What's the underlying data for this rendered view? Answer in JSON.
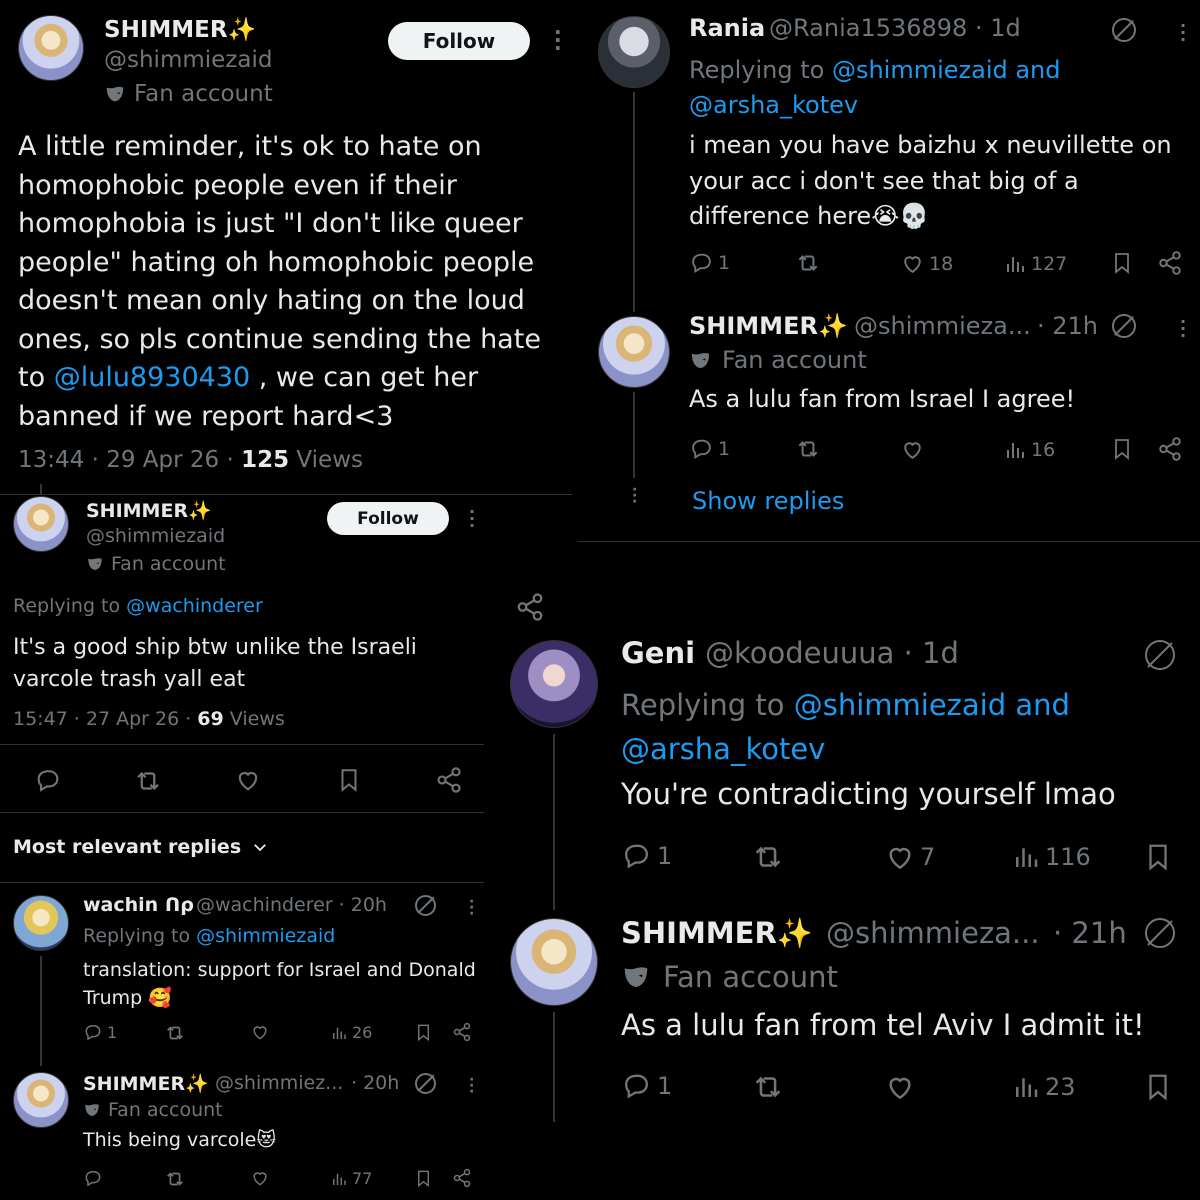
{
  "panel_tl": {
    "name": "SHIMMER✨",
    "handle": "@shimmiezaid",
    "badge": "Fan account",
    "follow": "Follow",
    "text_1": "A little reminder, it's ok to hate on",
    "text_2": "homophobic people even if their",
    "text_3": "homophobia is just \"I don't like queer",
    "text_4": "people\" hating oh homophobic people",
    "text_5": "doesn't mean only hating on the loud",
    "text_6": "ones, so pls continue sending the hate",
    "text_7a": "to ",
    "text_7_mention": "@lulu8930430",
    "text_7b": " , we can get her",
    "text_8": "banned if we report hard<3",
    "time": "13:44 · 29 Apr 26 · ",
    "views_count": "125",
    "views_label": " Views"
  },
  "panel_ml": {
    "name": "SHIMMER✨",
    "handle": "@shimmiezaid",
    "badge": "Fan account",
    "follow": "Follow",
    "replying_prefix": "Replying to ",
    "replying_to": "@wachinderer",
    "text_1": "It's a good ship btw unlike the Israeli",
    "text_2": "varcole trash yall eat",
    "time": "15:47 · 27 Apr 26 · ",
    "views_count": "69",
    "views_label": " Views",
    "sort_label": "Most relevant replies"
  },
  "reply_wachin": {
    "name": "wachin ᑎ⍴",
    "handle": "@wachinderer · 20h",
    "replying_prefix": "Replying to ",
    "replying_to": "@shimmiezaid",
    "text_1": "translation: support for Israel and Donald",
    "text_2": "Trump 🥰",
    "replies": "1",
    "views": "26"
  },
  "reply_shimmer_bl": {
    "name": "SHIMMER✨",
    "handle": "@shimmiez...",
    "time": "· 20h",
    "badge": "Fan account",
    "text": "This being varcole😻",
    "views": "77"
  },
  "reply_rania": {
    "name": "Rania",
    "handle": "@Rania1536898 · 1d",
    "replying_prefix": "Replying to ",
    "replying_to_1": "@shimmiezaid and",
    "replying_to_2": "@arsha_kotev",
    "text_1": "i mean you have baizhu x neuvillette on",
    "text_2": "your acc i don't see that big of a",
    "text_3": "difference here😭💀",
    "replies": "1",
    "likes": "18",
    "views": "127"
  },
  "reply_shimmer_tr": {
    "name": "SHIMMER✨",
    "handle": "@shimmieza...",
    "time": "· 21h",
    "badge": "Fan account",
    "text": "As a lulu fan from Israel I agree!",
    "replies": "1",
    "views": "16",
    "show_replies": "Show replies"
  },
  "reply_geni": {
    "name": "Geni",
    "handle": "@koodeuuua · 1d",
    "replying_prefix": "Replying to ",
    "replying_to_1": "@shimmiezaid and",
    "replying_to_2": "@arsha_kotev",
    "text": "You're contradicting yourself lmao",
    "replies": "1",
    "likes": "7",
    "views": "116"
  },
  "reply_shimmer_br": {
    "name": "SHIMMER✨",
    "handle": "@shimmieza...",
    "time": "· 21h",
    "badge": "Fan account",
    "text": "As a lulu fan from tel Aviv I admit it!",
    "replies": "1",
    "views": "23"
  },
  "colors": {
    "background": "#000000",
    "text": "#e7e9ea",
    "muted": "#71767b",
    "link": "#1d9bf0",
    "follow_bg": "#eff3f4"
  }
}
